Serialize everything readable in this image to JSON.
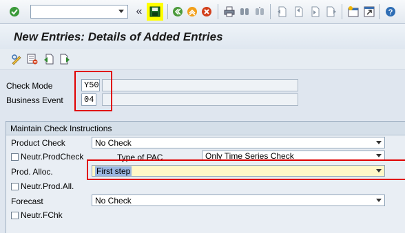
{
  "toolbar": {
    "command_value": "",
    "icons": [
      "enter-icon",
      "command-dropdown-icon",
      "collapse-icon",
      "save-icon",
      "back-icon",
      "exit-icon",
      "cancel-icon",
      "print-icon",
      "find-icon",
      "find-next-icon",
      "first-page-icon",
      "prev-page-icon",
      "next-page-icon",
      "last-page-icon",
      "create-session-icon",
      "shortcut-icon",
      "help-icon"
    ],
    "highlight_color": "#ffff00"
  },
  "title": "New Entries: Details of Added Entries",
  "app_toolbar": {
    "icons": [
      "display-change-icon",
      "delete-icon",
      "previous-entry-icon",
      "next-entry-icon"
    ]
  },
  "header_fields": {
    "check_mode": {
      "label": "Check Mode",
      "value": "Y50",
      "description": ""
    },
    "business_event": {
      "label": "Business Event",
      "value": "04",
      "description": ""
    }
  },
  "group": {
    "title": "Maintain Check Instructions",
    "product_check": {
      "label": "Product Check",
      "value": "No Check"
    },
    "neutr_prodcheck": {
      "label": "Neutr.ProdCheck",
      "checked": false
    },
    "type_of_pac": {
      "label": "Type of PAC",
      "value": "Only Time Series Check"
    },
    "prod_alloc": {
      "label": "Prod. Alloc.",
      "value": "First step"
    },
    "neutr_prodall": {
      "label": "Neutr.Prod.All.",
      "checked": false
    },
    "forecast": {
      "label": "Forecast",
      "value": "No Check"
    },
    "neutr_fchk": {
      "label": "Neutr.FChk",
      "checked": false
    }
  },
  "annotation_color": "#e00000"
}
